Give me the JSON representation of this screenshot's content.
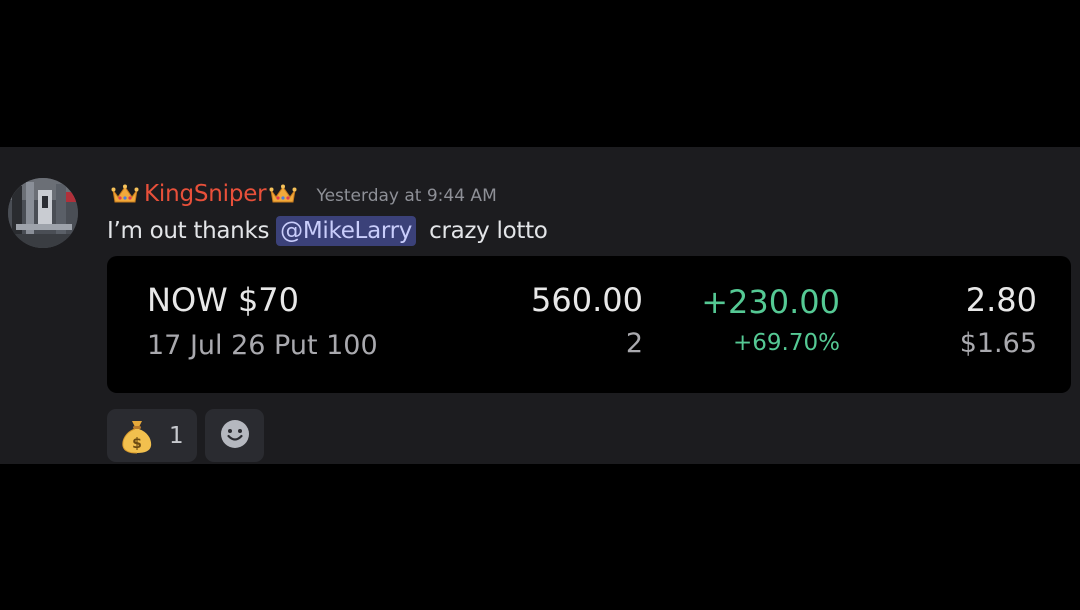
{
  "message": {
    "author": "KingSniper",
    "timestamp": "Yesterday at 9:44 AM",
    "text_before": "I’m out thanks",
    "mention": "@MikeLarry",
    "text_after": "crazy lotto",
    "colors": {
      "author": "#e8503a",
      "mention_bg": "#3b4179",
      "gain": "#55c994"
    }
  },
  "trade_card": {
    "title": "NOW $70",
    "subtitle": "17 Jul 26 Put 100",
    "value": "560.00",
    "quantity": "2",
    "gain": "+230.00",
    "gain_percent": "+69.70%",
    "price": "2.80",
    "cost": "$1.65"
  },
  "reactions": [
    {
      "icon": "money-bag-icon",
      "count": "1"
    }
  ],
  "add_reaction_icon": "smiley-face-icon"
}
